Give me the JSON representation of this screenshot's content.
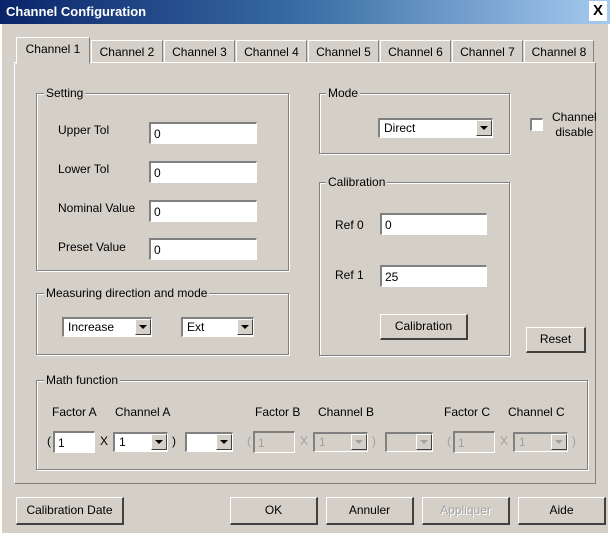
{
  "window": {
    "title": "Channel Configuration",
    "close_glyph": "X"
  },
  "tabs": [
    "Channel 1",
    "Channel 2",
    "Channel 3",
    "Channel 4",
    "Channel 5",
    "Channel 6",
    "Channel 7",
    "Channel 8"
  ],
  "setting": {
    "legend": "Setting",
    "upper_tol_label": "Upper Tol",
    "upper_tol_value": "0",
    "lower_tol_label": "Lower Tol",
    "lower_tol_value": "0",
    "nominal_label": "Nominal Value",
    "nominal_value": "0",
    "preset_label": "Preset Value",
    "preset_value": "0"
  },
  "mode": {
    "legend": "Mode",
    "value": "Direct"
  },
  "channel_disable": {
    "label_line1": "Channel",
    "label_line2": "disable",
    "checked": false
  },
  "calibration": {
    "legend": "Calibration",
    "ref0_label": "Ref 0",
    "ref0_value": "0",
    "ref1_label": "Ref 1",
    "ref1_value": "25",
    "button_label": "Calibration"
  },
  "measuring": {
    "legend": "Measuring direction and mode",
    "direction": "Increase",
    "mode": "Ext"
  },
  "reset_label": "Reset",
  "math": {
    "legend": "Math function",
    "factor_a_label": "Factor A",
    "channel_a_label": "Channel A",
    "factor_b_label": "Factor B",
    "channel_b_label": "Channel B",
    "factor_c_label": "Factor C",
    "channel_c_label": "Channel C",
    "factor_a_value": "1",
    "channel_a_value": "1",
    "factor_b_value": "1",
    "channel_b_value": "1",
    "factor_c_value": "1",
    "channel_c_value": "1",
    "open_paren": "(",
    "close_paren": ")",
    "times": "X"
  },
  "footer": {
    "calibration_date": "Calibration Date",
    "ok": "OK",
    "cancel": "Annuler",
    "apply": "Appliquer",
    "help": "Aide"
  }
}
